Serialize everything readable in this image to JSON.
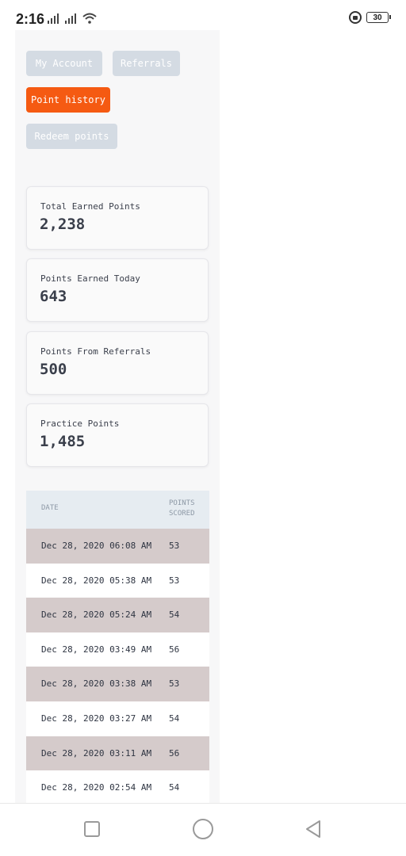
{
  "status_bar": {
    "time": "2:16",
    "battery": "30",
    "icons": [
      "signal-icon",
      "signal-icon",
      "wifi-icon",
      "lock-rotation-icon",
      "battery-icon"
    ]
  },
  "nav": {
    "my_account": "My Account",
    "referrals": "Referrals",
    "point_history": "Point history",
    "redeem_points": "Redeem points",
    "active": "point_history",
    "active_color": "#f55a12",
    "inactive_color": "#d4dbe3"
  },
  "stats": [
    {
      "label": "Total Earned Points",
      "value": "2,238"
    },
    {
      "label": "Points Earned Today",
      "value": "643"
    },
    {
      "label": "Points From Referrals",
      "value": "500"
    },
    {
      "label": "Practice Points",
      "value": "1,485"
    }
  ],
  "history": {
    "columns": {
      "date": "DATE",
      "points": "POINTS\nSCORED"
    },
    "rows": [
      {
        "date": "Dec 28, 2020 06:08 AM",
        "points": "53"
      },
      {
        "date": "Dec 28, 2020 05:38 AM",
        "points": "53"
      },
      {
        "date": "Dec 28, 2020 05:24 AM",
        "points": "54"
      },
      {
        "date": "Dec 28, 2020 03:49 AM",
        "points": "56"
      },
      {
        "date": "Dec 28, 2020 03:38 AM",
        "points": "53"
      },
      {
        "date": "Dec 28, 2020 03:27 AM",
        "points": "54"
      },
      {
        "date": "Dec 28, 2020 03:11 AM",
        "points": "56"
      },
      {
        "date": "Dec 28, 2020 02:54 AM",
        "points": "54"
      }
    ]
  },
  "system_nav": {
    "icons": [
      "recent-apps-icon",
      "home-icon",
      "back-icon"
    ]
  }
}
